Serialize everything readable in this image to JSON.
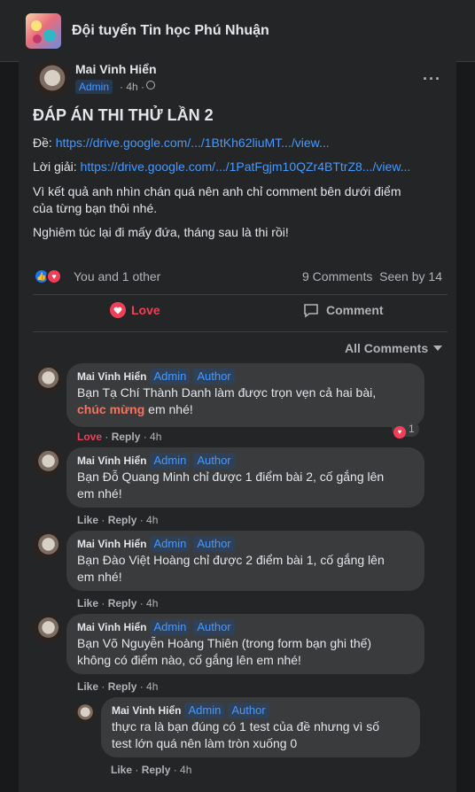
{
  "group": {
    "name": "Đội tuyển Tin học Phú Nhuận"
  },
  "post": {
    "author": "Mai Vinh Hiển",
    "badge": "Admin",
    "time": "4h",
    "title": "ĐÁP ÁN THI THỬ LẦN 2",
    "de_label": "Đề:",
    "de_link": "https://drive.google.com/.../1BtKh62liuMT.../view...",
    "loigiai_label": "Lời giải:",
    "loigiai_link": "https://drive.google.com/.../1PatFgjm10QZr4BTtrZ8.../view...",
    "body_line1": "Vì kết quả anh nhìn chán quá nên anh chỉ comment bên dưới điểm",
    "body_line2": "của từng bạn thôi nhé.",
    "body_line3": "Nghiêm túc lại đi mấy đứa, tháng sau là thi rồi!",
    "reactions": "You and 1 other",
    "comments_count": "9 Comments",
    "seen": "Seen by 14"
  },
  "actions": {
    "love": "Love",
    "comment": "Comment"
  },
  "filter": {
    "label": "All Comments"
  },
  "comments": [
    {
      "author": "Mai Vinh Hiển",
      "tag1": "Admin",
      "tag2": "Author",
      "line1": "Bạn Tạ Chí Thành Danh làm được trọn vẹn cả hai bài,",
      "strong": "chúc mừng",
      "line2_rest": " em nhé!",
      "like": "Love",
      "reply": "Reply",
      "time": "4h",
      "react_count": "1"
    },
    {
      "author": "Mai Vinh Hiển",
      "tag1": "Admin",
      "tag2": "Author",
      "line1": "Bạn Đỗ Quang Minh chỉ được 1 điểm bài 2, cố gắng lên",
      "line2": "em nhé!",
      "like": "Like",
      "reply": "Reply",
      "time": "4h"
    },
    {
      "author": "Mai Vinh Hiển",
      "tag1": "Admin",
      "tag2": "Author",
      "line1": "Bạn Đào Việt Hoàng chỉ được 2 điểm bài 1, cố gắng lên",
      "line2": "em nhé!",
      "like": "Like",
      "reply": "Reply",
      "time": "4h"
    },
    {
      "author": "Mai Vinh Hiển",
      "tag1": "Admin",
      "tag2": "Author",
      "line1": "Bạn Võ Nguyễn Hoàng Thiên (trong form bạn ghi thế)",
      "line2": "không có điểm nào, cố gắng lên em nhé!",
      "like": "Like",
      "reply": "Reply",
      "time": "4h"
    },
    {
      "author": "Mai Vinh Hiển",
      "tag1": "Admin",
      "tag2": "Author",
      "line1": "thực ra là bạn đúng có 1 test của đề nhưng vì số",
      "line2": "test lớn quá nên làm tròn xuống 0",
      "like": "Like",
      "reply": "Reply",
      "time": "4h"
    }
  ],
  "colors": {
    "accent": "#4599ff",
    "love": "#f33e58",
    "background": "#18191a",
    "card": "#242526"
  }
}
